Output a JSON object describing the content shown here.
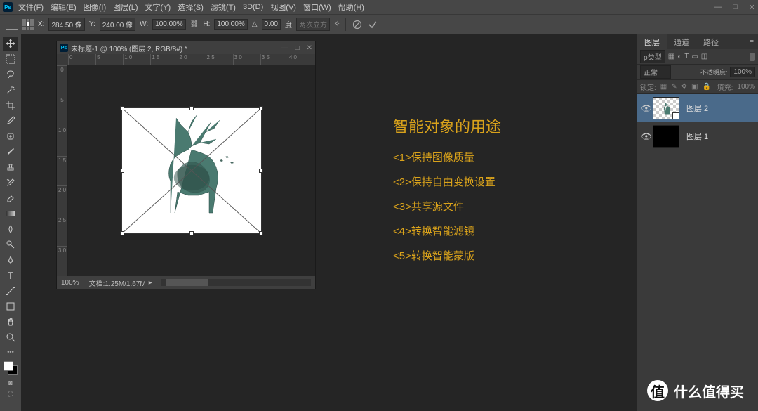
{
  "menu": {
    "items": [
      "文件(F)",
      "编辑(E)",
      "图像(I)",
      "图层(L)",
      "文字(Y)",
      "选择(S)",
      "滤镜(T)",
      "3D(D)",
      "视图(V)",
      "窗口(W)",
      "帮助(H)"
    ]
  },
  "options": {
    "x_label": "X:",
    "x": "284.50 像",
    "y_label": "Y:",
    "y": "240.00 像",
    "w_label": "W:",
    "w": "100.00%",
    "h_label": "H:",
    "h": "100.00%",
    "angle": "0.00",
    "deg": "度",
    "interp": "两次立方"
  },
  "doc": {
    "title": "未标题-1 @ 100% (图层 2, RGB/8#) *",
    "zoom": "100%",
    "filesize": "文档:1.25M/1.67M",
    "ruler_h": [
      "0",
      "5",
      "1 0",
      "1 5",
      "2 0",
      "2 5",
      "3 0",
      "3 5",
      "4 0"
    ],
    "ruler_v": [
      "0",
      "5",
      "1 0",
      "1 5",
      "2 0",
      "2 5",
      "3 0"
    ]
  },
  "annotation": {
    "title": "智能对象的用途",
    "items": [
      "<1>保持图像质量",
      "<2>保持自由变换设置",
      "<3>共享源文件",
      "<4>转换智能滤镜",
      "<5>转换智能蒙版"
    ]
  },
  "panels": {
    "tabs": [
      "图层",
      "通道",
      "路径"
    ],
    "kind": "ρ类型",
    "blend": "正常",
    "opacity_label": "不透明度:",
    "opacity": "100%",
    "lock": "锁定:",
    "fill_label": "填充:",
    "fill": "100%",
    "layers": [
      {
        "name": "图层 2"
      },
      {
        "name": "图层 1"
      }
    ]
  },
  "watermark": "什么值得买"
}
